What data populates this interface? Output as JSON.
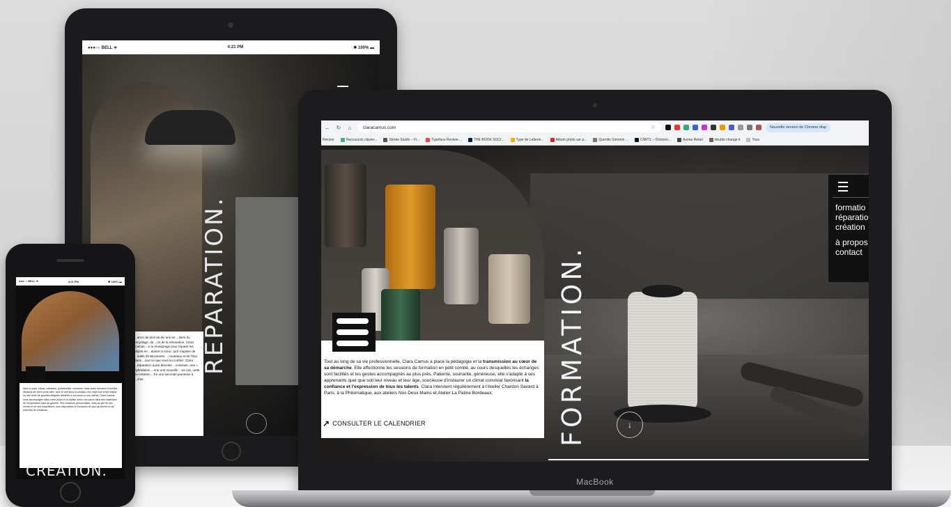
{
  "tablet": {
    "status": {
      "carrier": "●●●○○ BELL ᯤ",
      "time": "4:21 PM",
      "battery": "✱ 100% ▬"
    },
    "word": "RÉPARATION.",
    "text": "...ance de plus de dix ans en ...itiers du recyclage, du ...ns de la rénovation, Clara Camus ...e la réusignage pour réparer les objets en ...éparer à cœur, qu'il s'agisse de ...outils d'instruments. ...couteaux et de l'étui dans ...tout ce que vous lui confiez. Clara ...réparation aussi discrète ...contraire, une « hybridation ...nne une nouvelle ...es cas, cette co-création ...fre une seconde jeunesse à ...cher."
  },
  "phone": {
    "status": {
      "carrier": "●●●○○ BELL ᯤ",
      "time": "4:21 PM",
      "battery": "✱ 100% ▬"
    },
    "word": "CRÉATION.",
    "text": "Sacs à main, cabas, cartables, portefeuilles, ceintures, mais aussi bouclées d'oreilles, dessous de verre porte-clés : que ce soit pour la création d'un objet tout à fait unique ou une série de goodies élégants destinés à vos amis ou vos clients, Clara Camus vous accompagne dans votre projet et le réalise selon vos vœux dans des matériaux de récupération haut de gamme. Ses créations personnelles, nées au gré de ses envies et de ses inspirations, sont disponibles à l'occasion de pop-up stores ou de marchés de créateurs."
  },
  "laptop": {
    "brand": "MacBook",
    "browser": {
      "url": "claracamus.com",
      "update_button": "Nouvelle version de Chrome disp",
      "bookmarks": [
        "Recizer",
        "Raccourcis clavier...",
        "Stroke Studio – Fi...",
        "Typeface Review:...",
        "THE BOOK SOCI...",
        "Type de Letterin...",
        "Album photo sur p...",
        "Quentin Simonin ...",
        "CNRTL – Dictionn...",
        "Axone Rebel",
        "double change it",
        "Tous"
      ]
    },
    "site": {
      "word": "FORMATION.",
      "body_intro": "Tout au long de sa vie professionnelle, Clara Camus a placé la pédagogie et la ",
      "body_bold1": "transmission au cœur de sa démarche",
      "body_mid1": ". Elle affectionne les sessions de formation en petit comité, au cours desquelles les échanges sont facilités et les gestes accompagnés au plus près. Patiente, souriante, généreuse, elle s'adapte à ses apprenants quel que soit leur niveau et leur âge, soucieuse d'instaurer un climat convivial favorisant ",
      "body_bold2": "la confiance et l'expression de tous les talents",
      "body_end": ". Clara intervient régulièrement à l'Atelier Chardon Savard à Paris, à la Philomatique, aux ateliers Nos Deux Mains et Atelier La Patine Bordeaux.",
      "cta": "CONSULTER LE CALENDRIER",
      "menu": {
        "items": [
          "formatio",
          "réparatio",
          "création"
        ],
        "items2": [
          "à propos",
          "contact"
        ]
      }
    }
  }
}
